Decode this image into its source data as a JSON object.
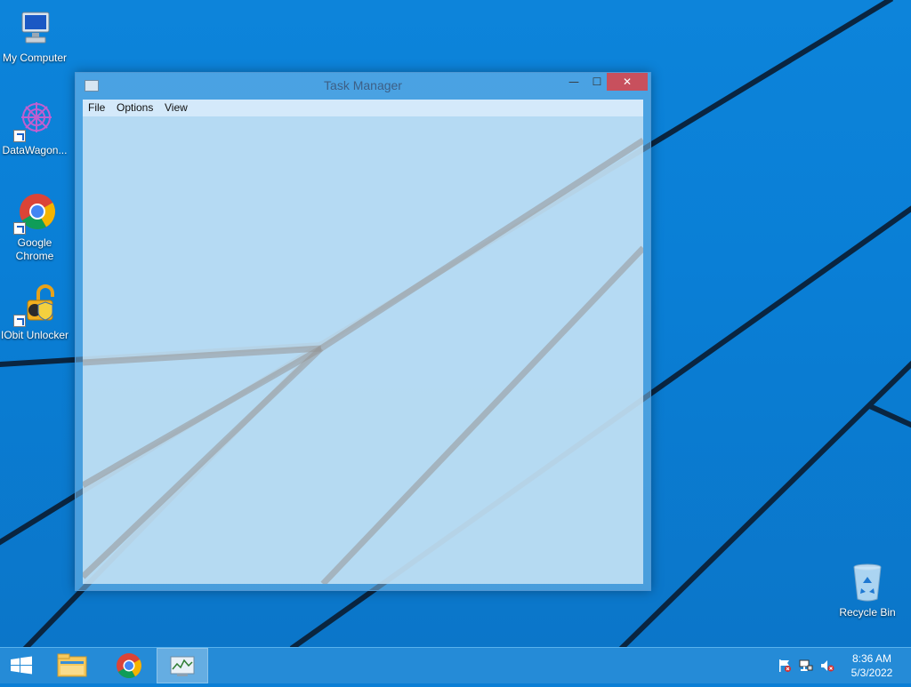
{
  "desktop": {
    "icons": [
      {
        "label": "My Computer",
        "icon": "my-computer-icon"
      },
      {
        "label": "DataWagon...",
        "icon": "datawagon-icon"
      },
      {
        "label": "Google Chrome",
        "icon": "google-chrome-icon"
      },
      {
        "label": "IObit Unlocker",
        "icon": "iobit-unlocker-icon"
      },
      {
        "label": "Recycle Bin",
        "icon": "recycle-bin-icon"
      }
    ]
  },
  "window": {
    "title": "Task Manager",
    "menu": [
      "File",
      "Options",
      "View"
    ],
    "controls": {
      "minimize": "—",
      "maximize": "☐",
      "close": "✕"
    }
  },
  "taskbar": {
    "items": [
      "start-icon",
      "file-explorer-icon",
      "google-chrome-icon",
      "task-manager-icon"
    ],
    "tray": [
      "action-center-flag-icon",
      "network-icon",
      "volume-muted-icon"
    ],
    "time": "8:36 AM",
    "date": "5/3/2022"
  },
  "colors": {
    "desktop_bg": "#0a7fd6",
    "close_button": "#c8505d",
    "taskbar": "#288cd7"
  }
}
